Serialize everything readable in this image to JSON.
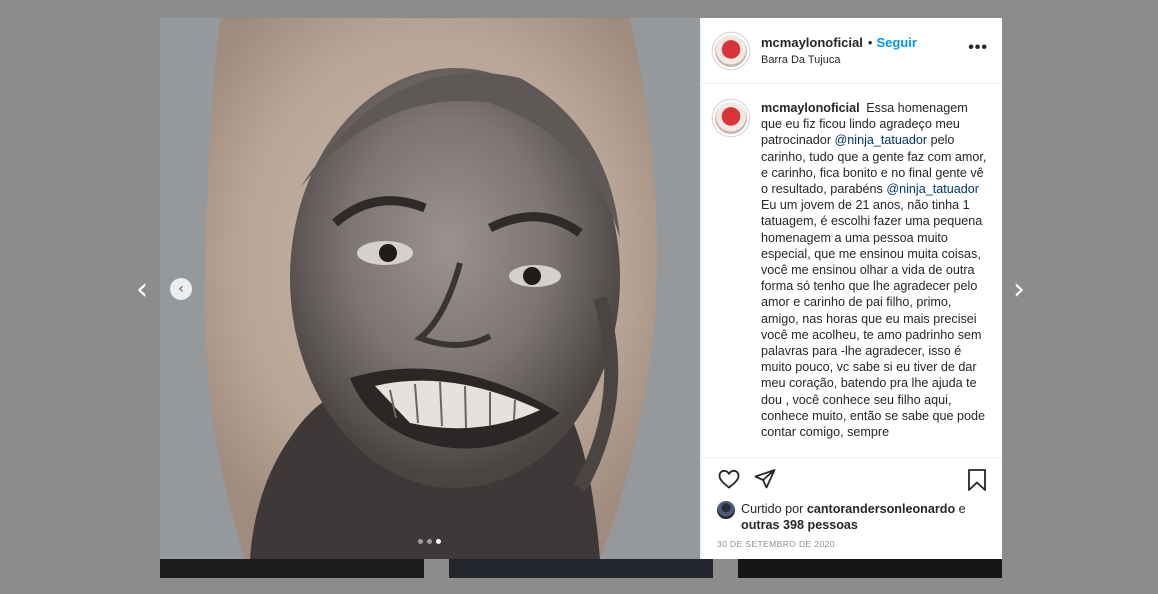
{
  "post": {
    "username": "mcmaylonoficial",
    "separator": "•",
    "follow_label": "Seguir",
    "location": "Barra Da Tujuca",
    "more_label": "•••",
    "caption": {
      "username": "mcmaylonoficial",
      "part1": "Essa homenagem que eu fiz ficou lindo agradeço meu patrocinador ",
      "mention1": "@ninja_tatuador",
      "part2": " pelo carinho, tudo que a gente faz com amor, e carinho, fica bonito e no final gente vê o resultado, parabéns ",
      "mention2": "@ninja_tatuador",
      "part3": " Eu um jovem de 21 anos, não tinha 1 tatuagem, é escolhi fazer uma pequena homenagem a uma pessoa muito especial, que me ensinou muita coisas, você me ensinou olhar a vida de outra forma só tenho que lhe agradecer pelo amor e carinho de pai filho, primo, amigo, nas horas que eu mais precisei você me acolheu, te amo padrinho sem palavras para -lhe agradecer, isso é muito pouco, vc sabe si eu tiver de dar meu coração, batendo pra lhe ajuda te dou , você conhece seu filho aqui, conhece muito, então se sabe que pode contar comigo, sempre"
    },
    "likes": {
      "prefix": "Curtido por ",
      "user": "cantorandersonleonardo",
      "middle": " e ",
      "others": "outras 398 pessoas"
    },
    "date": "30 DE SETEMBRO DE 2020",
    "carousel": {
      "total": 3,
      "active_index": 2
    }
  },
  "nav": {
    "prev_glyph": "‹",
    "next_glyph": "›",
    "carousel_prev_glyph": "‹"
  },
  "icons": {
    "heart": "heart-icon",
    "share": "paper-plane-icon",
    "save": "bookmark-icon",
    "more": "more-options-icon"
  },
  "colors": {
    "link": "#0095f6",
    "mention": "#00376b",
    "text": "#262626",
    "muted": "#8e8e8e",
    "backdrop": "#8c8c8c"
  }
}
